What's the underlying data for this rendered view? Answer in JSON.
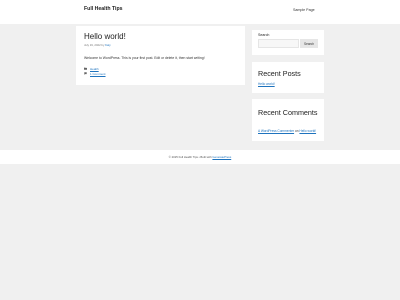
{
  "site": {
    "title": "Full Health Tips",
    "nav": {
      "sample_page": "Sample Page"
    }
  },
  "post": {
    "title": "Hello world!",
    "date": "July 19, 2022",
    "by": "by",
    "author": "Kaly",
    "content": "Welcome to WordPress. This is your first post. Edit or delete it, then start writing!",
    "category": "Health",
    "comment_link": "1 Comment"
  },
  "sidebar": {
    "search": {
      "label": "Search",
      "button": "Search",
      "placeholder": ""
    },
    "recent_posts": {
      "title": "Recent Posts",
      "items": [
        "Hello world!"
      ]
    },
    "recent_comments": {
      "title": "Recent Comments",
      "author": "A WordPress Commenter",
      "on": "on",
      "post": "Hello world!"
    }
  },
  "footer": {
    "copyright": "© 2025 Full Health Tips • Built with",
    "builder": "GeneratePress"
  }
}
